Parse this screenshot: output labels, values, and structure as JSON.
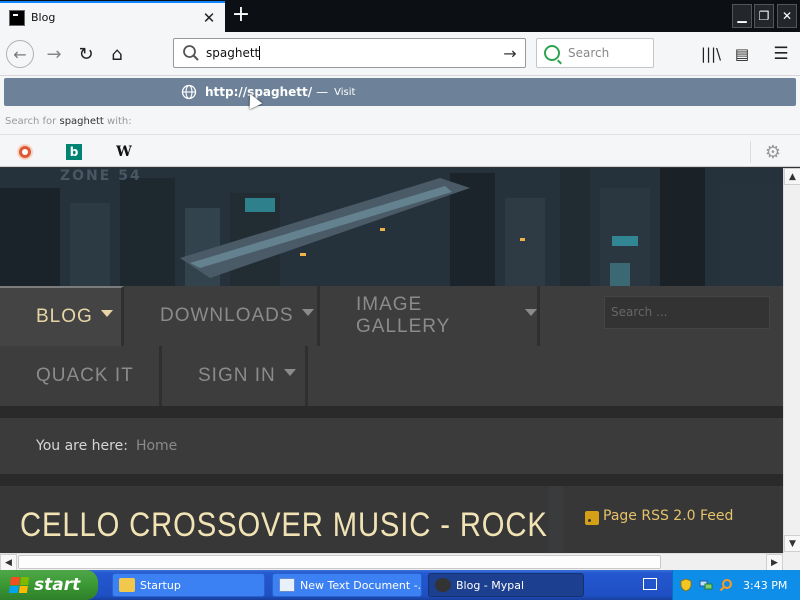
{
  "browser": {
    "tab": {
      "title": "Blog",
      "close": "✕"
    },
    "new_tab": "+",
    "window_controls": {
      "minimize": "▁",
      "restore": "❐",
      "close": "✕"
    },
    "nav": {
      "back": "←",
      "forward": "→",
      "reload": "↻",
      "home": "⌂"
    },
    "urlbar": {
      "value": "spaghett",
      "go": "→"
    },
    "searchbox": {
      "placeholder": "Search"
    },
    "toolbar": {
      "library": "|||\\",
      "sidebar": "▤",
      "menu": "☰"
    },
    "dropdown": {
      "suggestion": {
        "url": "http://spaghett/",
        "separator": "—",
        "action": "Visit"
      },
      "search_with": {
        "prefix": "Search for",
        "term": "spaghett",
        "suffix": "with:"
      },
      "engines": {
        "bing": "b",
        "wikipedia": "W",
        "settings": "⚙"
      }
    }
  },
  "page": {
    "banner": {
      "logo": "ZONE 54"
    },
    "menu": {
      "blog": "BLOG",
      "downloads": "DOWNLOADS",
      "gallery": "IMAGE GALLERY",
      "quack": "QUACK IT",
      "signin": "SIGN IN"
    },
    "search": {
      "placeholder": "Search ..."
    },
    "breadcrumb": {
      "label": "You are here:",
      "home": "Home"
    },
    "article": {
      "title": "CELLO CROSSOVER MUSIC - ROCK"
    },
    "sidebar": {
      "rss": "Page RSS 2.0 Feed"
    }
  },
  "scrollbars": {
    "up": "▲",
    "down": "▼",
    "left": "◀",
    "right": "▶",
    "grip": "|||"
  },
  "taskbar": {
    "start": "start",
    "tasks": [
      {
        "label": "Startup"
      },
      {
        "label": "New Text Document -..."
      },
      {
        "label": "Blog - Mypal"
      }
    ],
    "clock": "3:43 PM"
  },
  "colors": {
    "accent_tab": "#0a84ff",
    "menu_active": "#e8d7a4",
    "title": "#f2e3b5",
    "rss": "#e6c36a",
    "taskbar": "#2458d0",
    "start": "#3c9a35"
  }
}
